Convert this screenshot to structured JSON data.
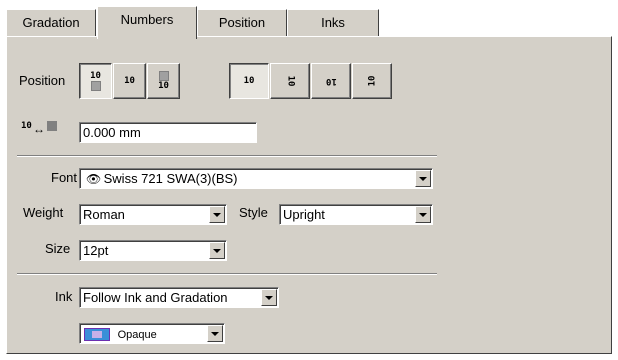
{
  "tabs": [
    "Gradation",
    "Numbers",
    "Position",
    "Inks"
  ],
  "position": {
    "label": "Position",
    "group1": [
      "10",
      "10",
      "10"
    ],
    "group2": [
      "10",
      "10",
      "10",
      "10"
    ]
  },
  "offset": {
    "icon_text": "10",
    "value": "0.000 mm"
  },
  "font": {
    "label": "Font",
    "value": "Swiss 721 SWA(3)(BS)"
  },
  "weight": {
    "label": "Weight",
    "value": "Roman"
  },
  "style": {
    "label": "Style",
    "value": "Upright"
  },
  "size": {
    "label": "Size",
    "value": "12pt"
  },
  "ink": {
    "label": "Ink",
    "value": "Follow Ink and Gradation"
  },
  "opacity": {
    "value": "Opaque"
  }
}
